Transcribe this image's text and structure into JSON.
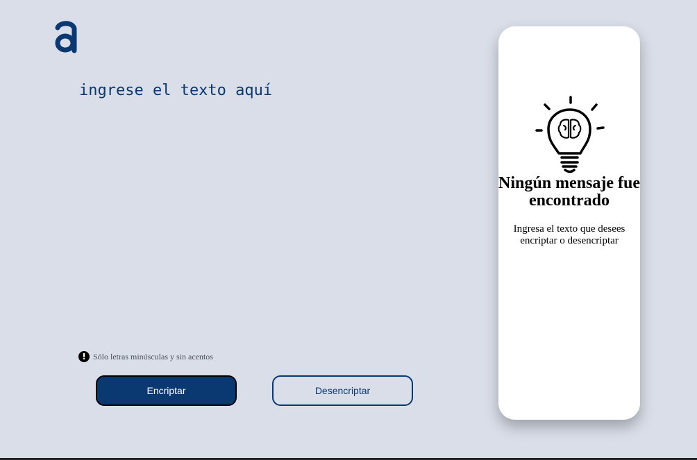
{
  "logo": {
    "icon": "alura-logo-icon"
  },
  "input": {
    "placeholder": "ingrese el texto aquí",
    "value": ""
  },
  "hint": {
    "icon": "exclamation-icon",
    "text": "Sólo letras minúsculas y sin acentos"
  },
  "buttons": {
    "encrypt_label": "Encriptar",
    "decrypt_label": "Desencriptar"
  },
  "output_panel": {
    "icon": "lightbulb-brain-icon",
    "title": "Ningún mensaje fue encontrado",
    "text": "Ingresa el texto que desees encriptar o desencriptar"
  },
  "colors": {
    "background": "#d9dee8",
    "accent": "#0a3871",
    "panel": "#ffffff",
    "hint_text": "#495057"
  }
}
